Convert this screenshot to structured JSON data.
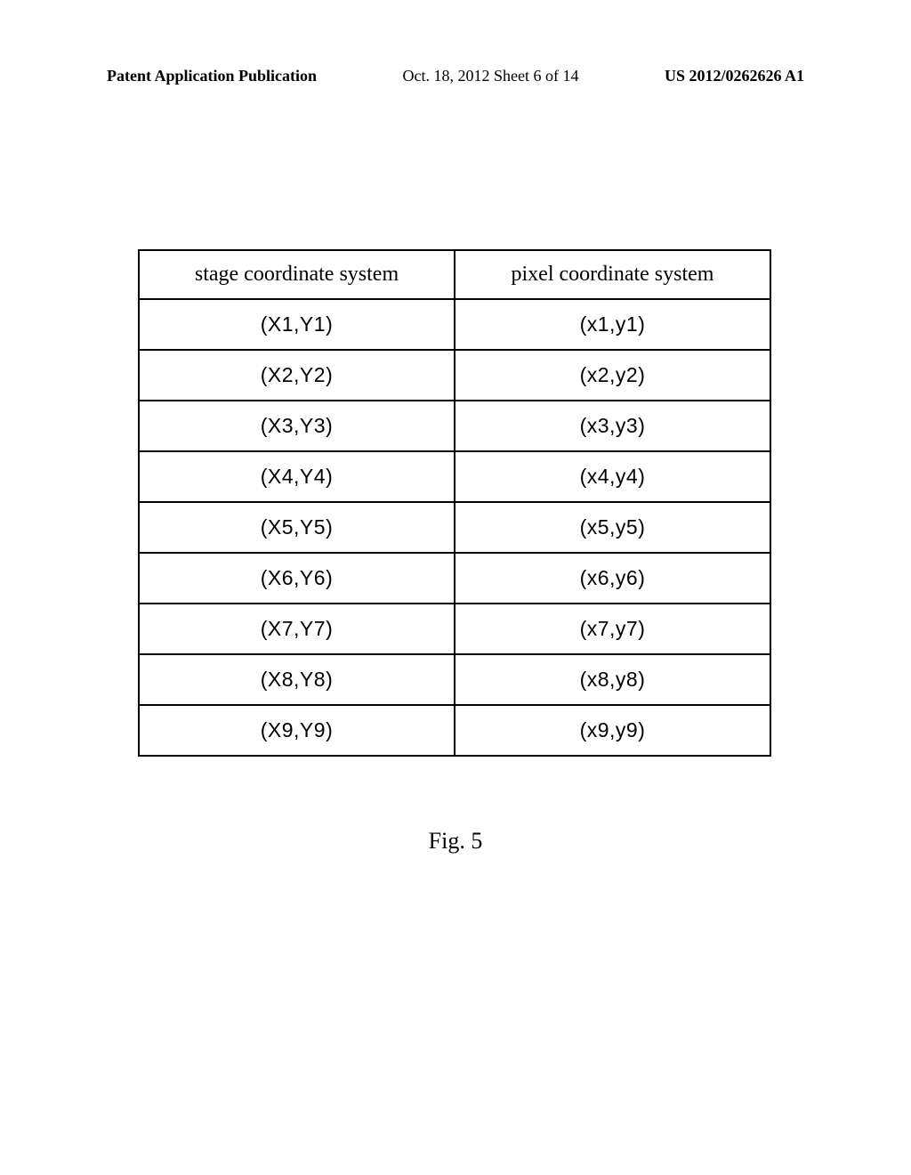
{
  "header": {
    "left": "Patent Application Publication",
    "center": "Oct. 18, 2012  Sheet 6 of 14",
    "right": "US 2012/0262626 A1"
  },
  "table": {
    "headers": {
      "col1": "stage coordinate system",
      "col2": "pixel coordinate system"
    },
    "rows": [
      {
        "col1": "(X1,Y1)",
        "col2": "(x1,y1)"
      },
      {
        "col1": "(X2,Y2)",
        "col2": "(x2,y2)"
      },
      {
        "col1": "(X3,Y3)",
        "col2": "(x3,y3)"
      },
      {
        "col1": "(X4,Y4)",
        "col2": "(x4,y4)"
      },
      {
        "col1": "(X5,Y5)",
        "col2": "(x5,y5)"
      },
      {
        "col1": "(X6,Y6)",
        "col2": "(x6,y6)"
      },
      {
        "col1": "(X7,Y7)",
        "col2": "(x7,y7)"
      },
      {
        "col1": "(X8,Y8)",
        "col2": "(x8,y8)"
      },
      {
        "col1": "(X9,Y9)",
        "col2": "(x9,y9)"
      }
    ]
  },
  "figure_caption": "Fig. 5"
}
